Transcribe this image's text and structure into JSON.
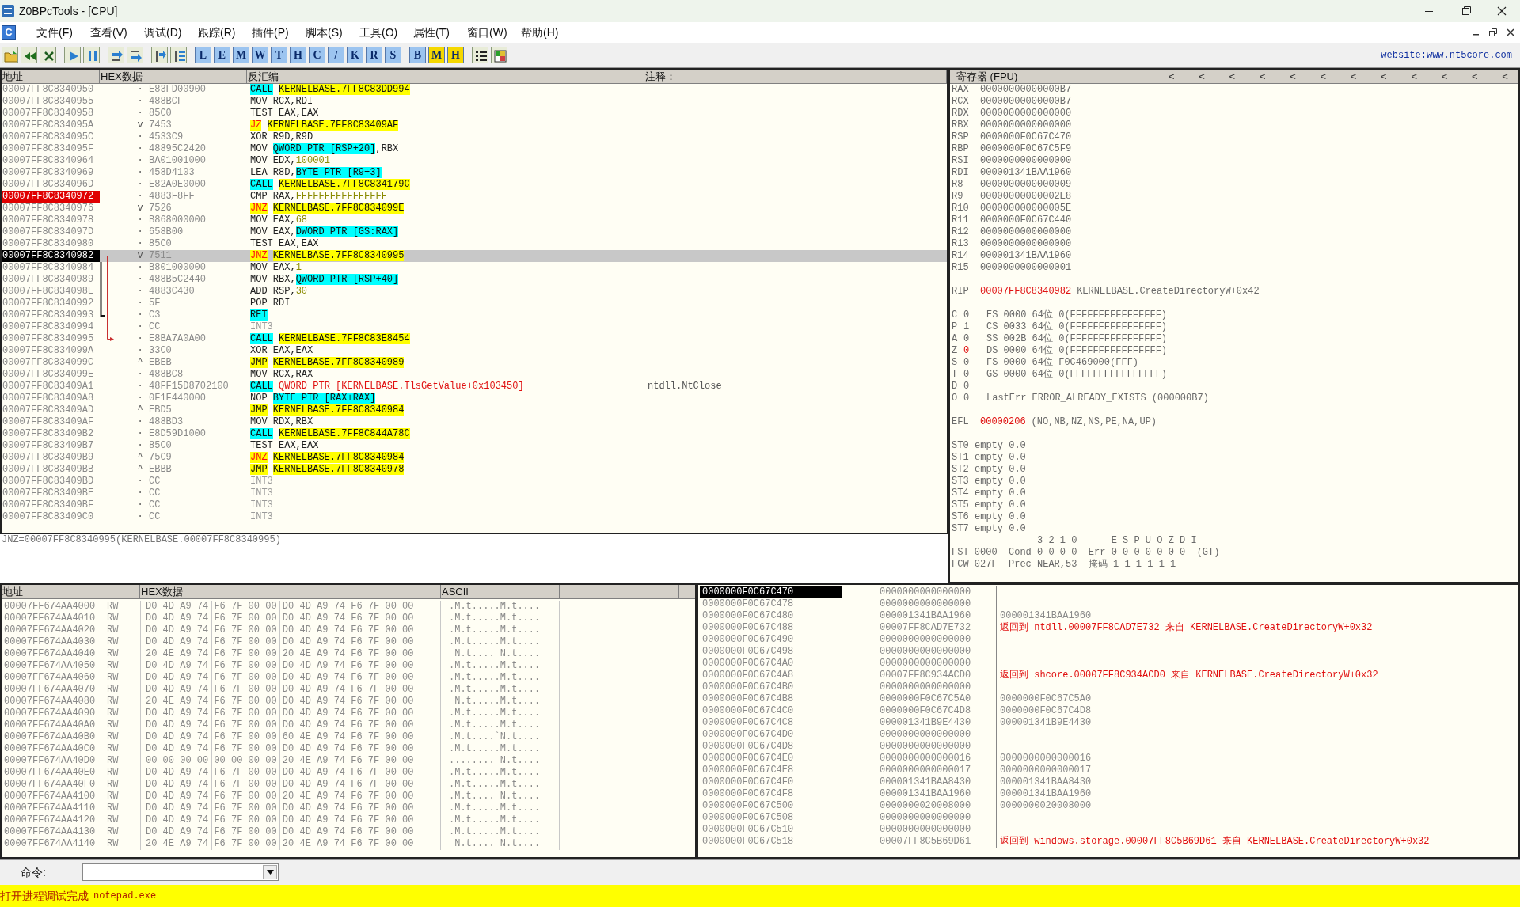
{
  "window": {
    "title": "Z0BPcTools - [CPU]"
  },
  "menu": {
    "icon_label": "C",
    "items": [
      "文件(F)",
      "查看(V)",
      "调试(D)",
      "跟踪(R)",
      "插件(P)",
      "脚本(S)",
      "工具(O)",
      "属性(T)",
      "窗口(W)",
      "帮助(H)"
    ]
  },
  "toolbar": [
    [
      {
        "kind": "open"
      },
      {
        "kind": "rewind"
      },
      {
        "kind": "close"
      }
    ],
    [
      {
        "kind": "run"
      },
      {
        "kind": "pause"
      }
    ],
    [
      {
        "kind": "stepin"
      },
      {
        "kind": "stepover"
      }
    ],
    [
      {
        "kind": "tracein"
      },
      {
        "kind": "traceover"
      }
    ],
    [
      {
        "kind": "letter",
        "label": "L",
        "color": "#9cc4f0"
      },
      {
        "kind": "letter",
        "label": "E",
        "color": "#9cc4f0"
      },
      {
        "kind": "letter",
        "label": "M",
        "color": "#9cc4f0"
      },
      {
        "kind": "letter",
        "label": "W",
        "color": "#9cc4f0"
      },
      {
        "kind": "letter",
        "label": "T",
        "color": "#9cc4f0"
      },
      {
        "kind": "letter",
        "label": "H",
        "color": "#9cc4f0"
      },
      {
        "kind": "letter",
        "label": "C",
        "color": "#9cc4f0"
      },
      {
        "kind": "letter",
        "label": "/",
        "color": "#9cc4f0"
      },
      {
        "kind": "letter",
        "label": "K",
        "color": "#9cc4f0"
      },
      {
        "kind": "letter",
        "label": "R",
        "color": "#9cc4f0"
      },
      {
        "kind": "letter",
        "label": "S",
        "color": "#9cc4f0"
      }
    ],
    [
      {
        "kind": "letter",
        "label": "B",
        "color": "#9cc4f0"
      },
      {
        "kind": "letter",
        "label": "M",
        "color": "#f5d800"
      },
      {
        "kind": "letter",
        "label": "H",
        "color": "#f5d800"
      }
    ],
    [
      {
        "kind": "list"
      },
      {
        "kind": "grid"
      }
    ]
  ],
  "website": "website:www.nt5core.com",
  "disassembly": {
    "columns": [
      "地址",
      "HEX数据",
      "反汇编",
      "注释："
    ],
    "rows": [
      {
        "address": "00007FF8C8340950",
        "mark": "·",
        "hex": "E83FD00900",
        "code": [
          {
            "text": "CALL",
            "kind": "call"
          },
          {
            "text": "KERNELBASE.7FF8C83DD994",
            "kind": "target"
          }
        ],
        "selected": false,
        "breakpoint": false
      },
      {
        "address": "00007FF8C8340955",
        "mark": "·",
        "hex": "488BCF",
        "code": [
          {
            "text": "MOV",
            "kind": "op"
          },
          {
            "text": "RCX,RDI",
            "kind": "text"
          }
        ],
        "selected": false,
        "breakpoint": false
      },
      {
        "address": "00007FF8C8340958",
        "mark": "·",
        "hex": "85C0",
        "code": [
          {
            "text": "TEST",
            "kind": "op"
          },
          {
            "text": "EAX,EAX",
            "kind": "text"
          }
        ],
        "selected": false,
        "breakpoint": false
      },
      {
        "address": "00007FF8C834095A",
        "mark": "v",
        "hex": "7453",
        "code": [
          {
            "text": "JZ",
            "kind": "jcc"
          },
          {
            "text": "KERNELBASE.7FF8C83409AF",
            "kind": "target"
          }
        ],
        "selected": false,
        "breakpoint": false
      },
      {
        "address": "00007FF8C834095C",
        "mark": "·",
        "hex": "4533C9",
        "code": [
          {
            "text": "XOR",
            "kind": "op"
          },
          {
            "text": "R9D,R9D",
            "kind": "text"
          }
        ],
        "selected": false,
        "breakpoint": false
      },
      {
        "address": "00007FF8C834095F",
        "mark": "·",
        "hex": "48895C2420",
        "code": [
          {
            "text": "MOV",
            "kind": "op"
          },
          {
            "text": "QWORD PTR [RSP+20]",
            "kind": "mem"
          },
          {
            "text": ",RBX",
            "kind": "text"
          }
        ],
        "selected": false,
        "breakpoint": false
      },
      {
        "address": "00007FF8C8340964",
        "mark": "·",
        "hex": "BA01001000",
        "code": [
          {
            "text": "MOV",
            "kind": "op"
          },
          {
            "text": "EDX,",
            "kind": "text"
          },
          {
            "text": "100001",
            "kind": "num"
          }
        ],
        "selected": false,
        "breakpoint": false
      },
      {
        "address": "00007FF8C8340969",
        "mark": "·",
        "hex": "458D4103",
        "code": [
          {
            "text": "LEA",
            "kind": "op"
          },
          {
            "text": "R8D,",
            "kind": "text"
          },
          {
            "text": "BYTE PTR [R9+3]",
            "kind": "mem"
          }
        ],
        "selected": false,
        "breakpoint": false
      },
      {
        "address": "00007FF8C834096D",
        "mark": "·",
        "hex": "E82A0E0000",
        "code": [
          {
            "text": "CALL",
            "kind": "call"
          },
          {
            "text": "KERNELBASE.7FF8C834179C",
            "kind": "target"
          }
        ],
        "selected": false,
        "breakpoint": false
      },
      {
        "address": "00007FF8C8340972",
        "mark": "·",
        "hex": "4883F8FF",
        "code": [
          {
            "text": "CMP",
            "kind": "op"
          },
          {
            "text": "RAX,",
            "kind": "text"
          },
          {
            "text": "FFFFFFFFFFFFFFFF",
            "kind": "num"
          }
        ],
        "selected": false,
        "breakpoint": true
      },
      {
        "address": "00007FF8C8340976",
        "mark": "v",
        "hex": "7526",
        "code": [
          {
            "text": "JNZ",
            "kind": "jcc"
          },
          {
            "text": "KERNELBASE.7FF8C834099E",
            "kind": "target"
          }
        ],
        "selected": false,
        "breakpoint": false
      },
      {
        "address": "00007FF8C8340978",
        "mark": "·",
        "hex": "B868000000",
        "code": [
          {
            "text": "MOV",
            "kind": "op"
          },
          {
            "text": "EAX,",
            "kind": "text"
          },
          {
            "text": "68",
            "kind": "num"
          }
        ],
        "selected": false,
        "breakpoint": false
      },
      {
        "address": "00007FF8C834097D",
        "mark": "·",
        "hex": "658B00",
        "code": [
          {
            "text": "MOV",
            "kind": "op"
          },
          {
            "text": "EAX,",
            "kind": "text"
          },
          {
            "text": "DWORD PTR [GS:RAX]",
            "kind": "mem"
          }
        ],
        "selected": false,
        "breakpoint": false
      },
      {
        "address": "00007FF8C8340980",
        "mark": "·",
        "hex": "85C0",
        "code": [
          {
            "text": "TEST",
            "kind": "op"
          },
          {
            "text": "EAX,EAX",
            "kind": "text"
          }
        ],
        "selected": false,
        "breakpoint": false
      },
      {
        "address": "00007FF8C8340982",
        "mark": "v",
        "hex": "7511",
        "code": [
          {
            "text": "JNZ",
            "kind": "jcc"
          },
          {
            "text": "KERNELBASE.7FF8C8340995",
            "kind": "target"
          }
        ],
        "selected": true,
        "breakpoint": false,
        "jump_from": true
      },
      {
        "address": "00007FF8C8340984",
        "mark": "·",
        "hex": "B801000000",
        "code": [
          {
            "text": "MOV",
            "kind": "op"
          },
          {
            "text": "EAX,",
            "kind": "text"
          },
          {
            "text": "1",
            "kind": "num"
          }
        ],
        "selected": false,
        "breakpoint": false,
        "bracket_from": true
      },
      {
        "address": "00007FF8C8340989",
        "mark": "·",
        "hex": "488B5C2440",
        "code": [
          {
            "text": "MOV",
            "kind": "op"
          },
          {
            "text": "RBX,",
            "kind": "text"
          },
          {
            "text": "QWORD PTR [RSP+40]",
            "kind": "mem"
          }
        ],
        "selected": false,
        "breakpoint": false
      },
      {
        "address": "00007FF8C834098E",
        "mark": "·",
        "hex": "4883C430",
        "code": [
          {
            "text": "ADD",
            "kind": "op"
          },
          {
            "text": "RSP,",
            "kind": "text"
          },
          {
            "text": "30",
            "kind": "num"
          }
        ],
        "selected": false,
        "breakpoint": false
      },
      {
        "address": "00007FF8C8340992",
        "mark": "·",
        "hex": "5F",
        "code": [
          {
            "text": "POP",
            "kind": "op"
          },
          {
            "text": "RDI",
            "kind": "text"
          }
        ],
        "selected": false,
        "breakpoint": false
      },
      {
        "address": "00007FF8C8340993",
        "mark": "·",
        "hex": "C3",
        "code": [
          {
            "text": "RET",
            "kind": "call"
          }
        ],
        "selected": false,
        "breakpoint": false,
        "bracket_to": true
      },
      {
        "address": "00007FF8C8340994",
        "mark": "·",
        "hex": "CC",
        "code": [
          {
            "text": "INT3",
            "kind": "pad"
          }
        ],
        "selected": false,
        "breakpoint": false
      },
      {
        "address": "00007FF8C8340995",
        "mark": "·",
        "hex": "E8BA7A0A00",
        "code": [
          {
            "text": "CALL",
            "kind": "call"
          },
          {
            "text": "KERNELBASE.7FF8C83E8454",
            "kind": "target"
          }
        ],
        "selected": false,
        "breakpoint": false,
        "jump_to": true
      },
      {
        "address": "00007FF8C834099A",
        "mark": "·",
        "hex": "33C0",
        "code": [
          {
            "text": "XOR",
            "kind": "op"
          },
          {
            "text": "EAX,EAX",
            "kind": "text"
          }
        ],
        "selected": false,
        "breakpoint": false
      },
      {
        "address": "00007FF8C834099C",
        "mark": "^",
        "hex": "EBEB",
        "code": [
          {
            "text": "JMP",
            "kind": "jmp"
          },
          {
            "text": "KERNELBASE.7FF8C8340989",
            "kind": "target"
          }
        ],
        "selected": false,
        "breakpoint": false
      },
      {
        "address": "00007FF8C834099E",
        "mark": "·",
        "hex": "488BC8",
        "code": [
          {
            "text": "MOV",
            "kind": "op"
          },
          {
            "text": "RCX,RAX",
            "kind": "text"
          }
        ],
        "selected": false,
        "breakpoint": false
      },
      {
        "address": "00007FF8C83409A1",
        "mark": "·",
        "hex": "48FF15D8702100",
        "code": [
          {
            "text": "CALL",
            "kind": "call"
          },
          {
            "text": "QWORD PTR [KERNELBASE.TlsGetValue+0x103450]",
            "kind": "sym"
          }
        ],
        "comment": "ntdll.NtClose",
        "selected": false,
        "breakpoint": false
      },
      {
        "address": "00007FF8C83409A8",
        "mark": "·",
        "hex": "0F1F440000",
        "code": [
          {
            "text": "NOP",
            "kind": "op"
          },
          {
            "text": "BYTE PTR [RAX+RAX]",
            "kind": "mem"
          }
        ],
        "selected": false,
        "breakpoint": false
      },
      {
        "address": "00007FF8C83409AD",
        "mark": "^",
        "hex": "EBD5",
        "code": [
          {
            "text": "JMP",
            "kind": "jmp"
          },
          {
            "text": "KERNELBASE.7FF8C8340984",
            "kind": "target"
          }
        ],
        "selected": false,
        "breakpoint": false
      },
      {
        "address": "00007FF8C83409AF",
        "mark": "·",
        "hex": "488BD3",
        "code": [
          {
            "text": "MOV",
            "kind": "op"
          },
          {
            "text": "RDX,RBX",
            "kind": "text"
          }
        ],
        "selected": false,
        "breakpoint": false
      },
      {
        "address": "00007FF8C83409B2",
        "mark": "·",
        "hex": "E8D59D1000",
        "code": [
          {
            "text": "CALL",
            "kind": "call"
          },
          {
            "text": "KERNELBASE.7FF8C844A78C",
            "kind": "target"
          }
        ],
        "selected": false,
        "breakpoint": false
      },
      {
        "address": "00007FF8C83409B7",
        "mark": "·",
        "hex": "85C0",
        "code": [
          {
            "text": "TEST",
            "kind": "op"
          },
          {
            "text": "EAX,EAX",
            "kind": "text"
          }
        ],
        "selected": false,
        "breakpoint": false
      },
      {
        "address": "00007FF8C83409B9",
        "mark": "^",
        "hex": "75C9",
        "code": [
          {
            "text": "JNZ",
            "kind": "jcc"
          },
          {
            "text": "KERNELBASE.7FF8C8340984",
            "kind": "target"
          }
        ],
        "selected": false,
        "breakpoint": false
      },
      {
        "address": "00007FF8C83409BB",
        "mark": "^",
        "hex": "EBBB",
        "code": [
          {
            "text": "JMP",
            "kind": "jmp"
          },
          {
            "text": "KERNELBASE.7FF8C8340978",
            "kind": "target"
          }
        ],
        "selected": false,
        "breakpoint": false
      },
      {
        "address": "00007FF8C83409BD",
        "mark": "·",
        "hex": "CC",
        "code": [
          {
            "text": "INT3",
            "kind": "pad"
          }
        ],
        "selected": false,
        "breakpoint": false
      },
      {
        "address": "00007FF8C83409BE",
        "mark": "·",
        "hex": "CC",
        "code": [
          {
            "text": "INT3",
            "kind": "pad"
          }
        ],
        "selected": false,
        "breakpoint": false
      },
      {
        "address": "00007FF8C83409BF",
        "mark": "·",
        "hex": "CC",
        "code": [
          {
            "text": "INT3",
            "kind": "pad"
          }
        ],
        "selected": false,
        "breakpoint": false
      },
      {
        "address": "00007FF8C83409C0",
        "mark": "·",
        "hex": "CC",
        "code": [
          {
            "text": "INT3",
            "kind": "pad"
          }
        ],
        "selected": false,
        "breakpoint": false
      }
    ]
  },
  "info_line": "JNZ=00007FF8C8340995(KERNELBASE.00007FF8C8340995)",
  "registers": {
    "title": "寄存器 (FPU)",
    "nav": [
      "<",
      "<",
      "<",
      "<",
      "<",
      "<",
      "<",
      "<",
      "<",
      "<",
      "<",
      "<"
    ],
    "general": [
      {
        "name": "RAX",
        "value": "00000000000000B7",
        "changed": false
      },
      {
        "name": "RCX",
        "value": "00000000000000B7",
        "changed": false
      },
      {
        "name": "RDX",
        "value": "0000000000000000",
        "changed": false
      },
      {
        "name": "RBX",
        "value": "0000000000000000",
        "changed": false
      },
      {
        "name": "RSP",
        "value": "0000000F0C67C470",
        "changed": false
      },
      {
        "name": "RBP",
        "value": "0000000F0C67C5F9",
        "changed": false
      },
      {
        "name": "RSI",
        "value": "0000000000000000",
        "changed": false
      },
      {
        "name": "RDI",
        "value": "000001341BAA1960",
        "changed": false
      },
      {
        "name": "R8",
        "value": "0000000000000009",
        "changed": false
      },
      {
        "name": "R9",
        "value": "00000000000002E8",
        "changed": false
      },
      {
        "name": "R10",
        "value": "000000000000005E",
        "changed": false
      },
      {
        "name": "R11",
        "value": "0000000F0C67C440",
        "changed": false
      },
      {
        "name": "R12",
        "value": "0000000000000000",
        "changed": false
      },
      {
        "name": "R13",
        "value": "0000000000000000",
        "changed": false
      },
      {
        "name": "R14",
        "value": "000001341BAA1960",
        "changed": false
      },
      {
        "name": "R15",
        "value": "0000000000000001",
        "changed": false
      }
    ],
    "rip": {
      "name": "RIP",
      "value": "00007FF8C8340982",
      "changed": true,
      "comment": "KERNELBASE.CreateDirectoryW+0x42"
    },
    "flags": [
      {
        "name": "C",
        "value": "0",
        "changed": false,
        "segment": "ES 0000 64位 0(FFFFFFFFFFFFFFFF)"
      },
      {
        "name": "P",
        "value": "1",
        "changed": false,
        "segment": "CS 0033 64位 0(FFFFFFFFFFFFFFFF)"
      },
      {
        "name": "A",
        "value": "0",
        "changed": false,
        "segment": "SS 002B 64位 0(FFFFFFFFFFFFFFFF)"
      },
      {
        "name": "Z",
        "value": "0",
        "changed": true,
        "segment": "DS 0000 64位 0(FFFFFFFFFFFFFFFF)"
      },
      {
        "name": "S",
        "value": "0",
        "changed": false,
        "segment": "FS 0000 64位 F0C469000(FFF)"
      },
      {
        "name": "T",
        "value": "0",
        "changed": false,
        "segment": "GS 0000 64位 0(FFFFFFFFFFFFFFFF)"
      },
      {
        "name": "D",
        "value": "0",
        "changed": false
      },
      {
        "name": "O",
        "value": "0",
        "changed": false,
        "segment": "LastErr ERROR_ALREADY_EXISTS (000000B7)"
      }
    ],
    "efl": {
      "name": "EFL",
      "value": "00000206",
      "changed": true,
      "decoded": "(NO,NB,NZ,NS,PE,NA,UP)"
    },
    "fpu": [
      {
        "name": "ST0",
        "value": "empty 0.0"
      },
      {
        "name": "ST1",
        "value": "empty 0.0"
      },
      {
        "name": "ST2",
        "value": "empty 0.0"
      },
      {
        "name": "ST3",
        "value": "empty 0.0"
      },
      {
        "name": "ST4",
        "value": "empty 0.0"
      },
      {
        "name": "ST5",
        "value": "empty 0.0"
      },
      {
        "name": "ST6",
        "value": "empty 0.0"
      },
      {
        "name": "ST7",
        "value": "empty 0.0"
      }
    ],
    "fpu_status": [
      "               3 2 1 0      E S P U O Z D I",
      "FST 0000  Cond 0 0 0 0  Err 0 0 0 0 0 0 0  (GT)",
      "FCW 027F  Prec NEAR,53  掩码 1 1 1 1 1 1"
    ]
  },
  "dump": {
    "columns": [
      "地址",
      "HEX数据",
      "ASCII"
    ],
    "rows": [
      {
        "address": "00007FF674AA4000",
        "access": "RW",
        "hex": "D0 4D A9 74 F6 7F 00 00 D0 4D A9 74 F6 7F 00 00",
        "ascii": ".M.t.....M.t...."
      },
      {
        "address": "00007FF674AA4010",
        "access": "RW",
        "hex": "D0 4D A9 74 F6 7F 00 00 D0 4D A9 74 F6 7F 00 00",
        "ascii": ".M.t.....M.t...."
      },
      {
        "address": "00007FF674AA4020",
        "access": "RW",
        "hex": "D0 4D A9 74 F6 7F 00 00 D0 4D A9 74 F6 7F 00 00",
        "ascii": ".M.t.....M.t...."
      },
      {
        "address": "00007FF674AA4030",
        "access": "RW",
        "hex": "D0 4D A9 74 F6 7F 00 00 D0 4D A9 74 F6 7F 00 00",
        "ascii": ".M.t.....M.t...."
      },
      {
        "address": "00007FF674AA4040",
        "access": "RW",
        "hex": "20 4E A9 74 F6 7F 00 00 20 4E A9 74 F6 7F 00 00",
        "ascii": " N.t.... N.t...."
      },
      {
        "address": "00007FF674AA4050",
        "access": "RW",
        "hex": "D0 4D A9 74 F6 7F 00 00 D0 4D A9 74 F6 7F 00 00",
        "ascii": ".M.t.....M.t...."
      },
      {
        "address": "00007FF674AA4060",
        "access": "RW",
        "hex": "D0 4D A9 74 F6 7F 00 00 D0 4D A9 74 F6 7F 00 00",
        "ascii": ".M.t.....M.t...."
      },
      {
        "address": "00007FF674AA4070",
        "access": "RW",
        "hex": "D0 4D A9 74 F6 7F 00 00 D0 4D A9 74 F6 7F 00 00",
        "ascii": ".M.t.....M.t...."
      },
      {
        "address": "00007FF674AA4080",
        "access": "RW",
        "hex": "20 4E A9 74 F6 7F 00 00 D0 4D A9 74 F6 7F 00 00",
        "ascii": " N.t.....M.t...."
      },
      {
        "address": "00007FF674AA4090",
        "access": "RW",
        "hex": "D0 4D A9 74 F6 7F 00 00 D0 4D A9 74 F6 7F 00 00",
        "ascii": ".M.t.....M.t...."
      },
      {
        "address": "00007FF674AA40A0",
        "access": "RW",
        "hex": "D0 4D A9 74 F6 7F 00 00 D0 4D A9 74 F6 7F 00 00",
        "ascii": ".M.t.....M.t...."
      },
      {
        "address": "00007FF674AA40B0",
        "access": "RW",
        "hex": "D0 4D A9 74 F6 7F 00 00 60 4E A9 74 F6 7F 00 00",
        "ascii": ".M.t....`N.t...."
      },
      {
        "address": "00007FF674AA40C0",
        "access": "RW",
        "hex": "D0 4D A9 74 F6 7F 00 00 D0 4D A9 74 F6 7F 00 00",
        "ascii": ".M.t.....M.t...."
      },
      {
        "address": "00007FF674AA40D0",
        "access": "RW",
        "hex": "00 00 00 00 00 00 00 00 20 4E A9 74 F6 7F 00 00",
        "ascii": "........ N.t...."
      },
      {
        "address": "00007FF674AA40E0",
        "access": "RW",
        "hex": "D0 4D A9 74 F6 7F 00 00 D0 4D A9 74 F6 7F 00 00",
        "ascii": ".M.t.....M.t...."
      },
      {
        "address": "00007FF674AA40F0",
        "access": "RW",
        "hex": "D0 4D A9 74 F6 7F 00 00 D0 4D A9 74 F6 7F 00 00",
        "ascii": ".M.t.....M.t...."
      },
      {
        "address": "00007FF674AA4100",
        "access": "RW",
        "hex": "D0 4D A9 74 F6 7F 00 00 20 4E A9 74 F6 7F 00 00",
        "ascii": ".M.t.... N.t...."
      },
      {
        "address": "00007FF674AA4110",
        "access": "RW",
        "hex": "D0 4D A9 74 F6 7F 00 00 D0 4D A9 74 F6 7F 00 00",
        "ascii": ".M.t.....M.t...."
      },
      {
        "address": "00007FF674AA4120",
        "access": "RW",
        "hex": "D0 4D A9 74 F6 7F 00 00 D0 4D A9 74 F6 7F 00 00",
        "ascii": ".M.t.....M.t...."
      },
      {
        "address": "00007FF674AA4130",
        "access": "RW",
        "hex": "D0 4D A9 74 F6 7F 00 00 D0 4D A9 74 F6 7F 00 00",
        "ascii": ".M.t.....M.t...."
      },
      {
        "address": "00007FF674AA4140",
        "access": "RW",
        "hex": "20 4E A9 74 F6 7F 00 00 20 4E A9 74 F6 7F 00 00",
        "ascii": " N.t.... N.t...."
      }
    ]
  },
  "stack": {
    "rows": [
      {
        "address": "0000000F0C67C470",
        "value": "0000000000000000",
        "selected": true
      },
      {
        "address": "0000000F0C67C478",
        "value": "0000000000000000",
        "selected": false
      },
      {
        "address": "0000000F0C67C480",
        "value": "000001341BAA1960",
        "kind": "plain",
        "comment": "000001341BAA1960",
        "selected": false
      },
      {
        "address": "0000000F0C67C488",
        "value": "00007FF8CAD7E732",
        "kind": "return",
        "comment": "返回到 ntdll.00007FF8CAD7E732 来自 KERNELBASE.CreateDirectoryW+0x32",
        "selected": false
      },
      {
        "address": "0000000F0C67C490",
        "value": "0000000000000000",
        "selected": false
      },
      {
        "address": "0000000F0C67C498",
        "value": "0000000000000000",
        "selected": false
      },
      {
        "address": "0000000F0C67C4A0",
        "value": "0000000000000000",
        "selected": false
      },
      {
        "address": "0000000F0C67C4A8",
        "value": "00007FF8C934ACD0",
        "kind": "return",
        "comment": "返回到 shcore.00007FF8C934ACD0 来自 KERNELBASE.CreateDirectoryW+0x32",
        "selected": false
      },
      {
        "address": "0000000F0C67C4B0",
        "value": "0000000000000000",
        "selected": false
      },
      {
        "address": "0000000F0C67C4B8",
        "value": "0000000F0C67C5A0",
        "kind": "plain",
        "comment": "0000000F0C67C5A0",
        "selected": false
      },
      {
        "address": "0000000F0C67C4C0",
        "value": "0000000F0C67C4D8",
        "kind": "plain",
        "comment": "0000000F0C67C4D8",
        "selected": false
      },
      {
        "address": "0000000F0C67C4C8",
        "value": "000001341B9E4430",
        "kind": "plain",
        "comment": "000001341B9E4430",
        "selected": false
      },
      {
        "address": "0000000F0C67C4D0",
        "value": "0000000000000000",
        "selected": false
      },
      {
        "address": "0000000F0C67C4D8",
        "value": "0000000000000000",
        "selected": false
      },
      {
        "address": "0000000F0C67C4E0",
        "value": "0000000000000016",
        "kind": "plain",
        "comment": "0000000000000016",
        "selected": false
      },
      {
        "address": "0000000F0C67C4E8",
        "value": "0000000000000017",
        "kind": "plain",
        "comment": "0000000000000017",
        "selected": false
      },
      {
        "address": "0000000F0C67C4F0",
        "value": "000001341BAA8430",
        "kind": "plain",
        "comment": "000001341BAA8430",
        "selected": false
      },
      {
        "address": "0000000F0C67C4F8",
        "value": "000001341BAA1960",
        "kind": "plain",
        "comment": "000001341BAA1960",
        "selected": false
      },
      {
        "address": "0000000F0C67C500",
        "value": "0000000020008000",
        "kind": "plain",
        "comment": "0000000020008000",
        "selected": false
      },
      {
        "address": "0000000F0C67C508",
        "value": "0000000000000000",
        "selected": false
      },
      {
        "address": "0000000F0C67C510",
        "value": "0000000000000000",
        "selected": false
      },
      {
        "address": "0000000F0C67C518",
        "value": "00007FF8C5B69D61",
        "kind": "return",
        "comment": "返回到 windows.storage.00007FF8C5B69D61 来自 KERNELBASE.CreateDirectoryW+0x32",
        "selected": false
      }
    ]
  },
  "command": {
    "label": "命令:"
  },
  "status_bar": {
    "text": "打开进程调试完成",
    "detail": "notepad.exe"
  }
}
